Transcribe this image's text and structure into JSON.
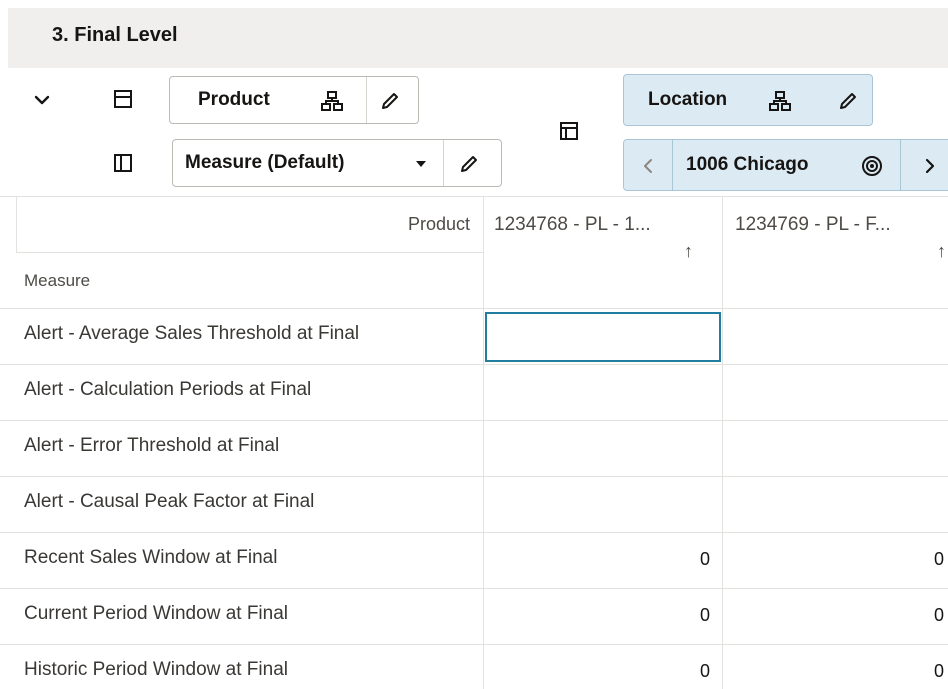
{
  "section": {
    "title": "3. Final Level"
  },
  "toolbar": {
    "collapse_icon": "chevron-down-icon",
    "row_layout_icon": "layout-rows-icon",
    "column_layout_icon": "layout-columns-icon",
    "pivot_icon": "pivot-icon"
  },
  "row_dims": [
    {
      "label": "Product",
      "icons": [
        "hierarchy-icon",
        "pencil-icon"
      ]
    },
    {
      "label": "Measure (Default)",
      "icons": [
        "caret-down-icon",
        "pencil-icon"
      ]
    }
  ],
  "column_dims": {
    "location": {
      "label": "Location",
      "icons": [
        "hierarchy-icon",
        "pencil-icon"
      ]
    },
    "page_selector": {
      "value": "1006 Chicago",
      "icons": [
        "chevron-left-icon",
        "target-icon",
        "chevron-right-icon"
      ]
    }
  },
  "grid": {
    "corner_product_label": "Product",
    "corner_measure_label": "Measure",
    "columns": [
      {
        "label": "1234768 - PL - 1...",
        "sort": "↑"
      },
      {
        "label": "1234769 - PL - F...",
        "sort": "↑"
      }
    ],
    "rows": [
      {
        "label": "Alert - Average Sales Threshold at Final",
        "values": [
          "",
          ""
        ]
      },
      {
        "label": "Alert - Calculation Periods at Final",
        "values": [
          "",
          ""
        ]
      },
      {
        "label": "Alert - Error Threshold at Final",
        "values": [
          "",
          ""
        ]
      },
      {
        "label": "Alert - Causal Peak Factor at Final",
        "values": [
          "",
          ""
        ]
      },
      {
        "label": "Recent Sales Window at Final",
        "values": [
          "0",
          "0"
        ]
      },
      {
        "label": "Current Period Window at Final",
        "values": [
          "0",
          "0"
        ]
      },
      {
        "label": "Historic Period Window at Final",
        "values": [
          "0",
          "0"
        ]
      }
    ]
  }
}
